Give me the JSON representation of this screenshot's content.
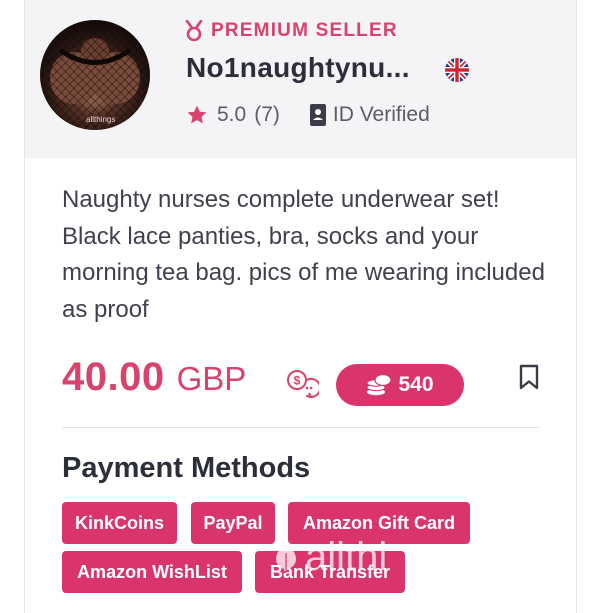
{
  "seller": {
    "badge_label": "PREMIUM SELLER",
    "name": "No1naughtynu...",
    "country_flag_icon": "uk-flag-icon",
    "rating": "5.0",
    "review_count": "(7)",
    "verification": "ID Verified",
    "avatar_watermark": "allthings"
  },
  "listing": {
    "description": "Naughty nurses complete underwear set! Black lace panties, bra, socks and your morning tea bag. pics of me wearing included as proof",
    "price": "40.00",
    "currency": "GBP",
    "coins": "540"
  },
  "payment": {
    "title": "Payment Methods",
    "methods": [
      "KinkCoins",
      "PayPal",
      "Amazon Gift Card",
      "Amazon WishList",
      "Bank Transfer"
    ]
  },
  "overlay": {
    "watermark": "allthi"
  },
  "colors": {
    "accent": "#d9356c",
    "header_bg": "#f4f4f6",
    "star": "#d8436e"
  }
}
